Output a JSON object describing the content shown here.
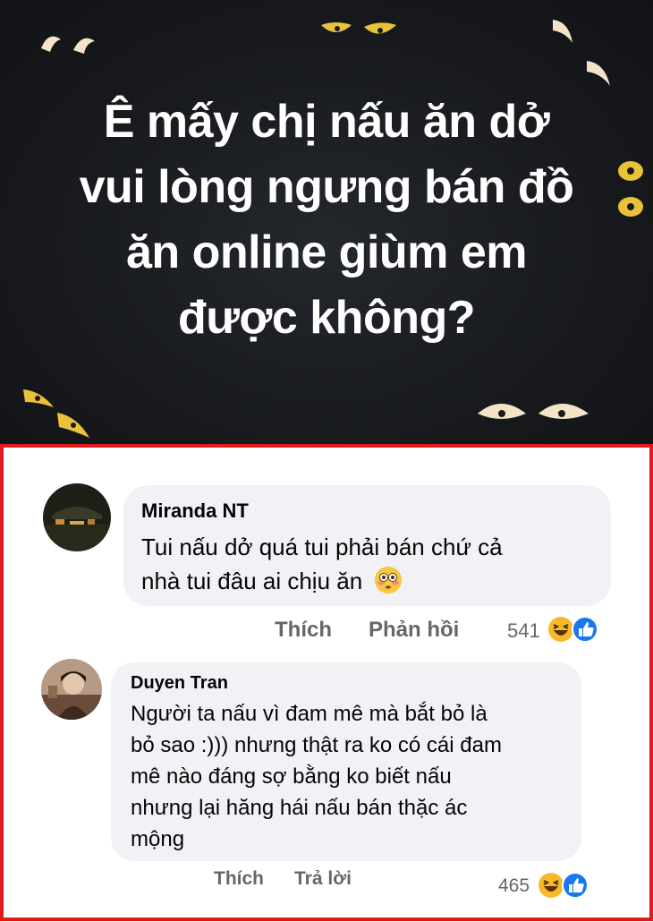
{
  "post": {
    "lines": [
      "Ê mấy chị nấu ăn dở",
      "vui lòng ngưng bán đồ",
      "ăn online giùm em",
      "được không?"
    ],
    "background_color": "#17191d",
    "text_color": "#ffffff"
  },
  "comments": [
    {
      "author": "Miranda NT",
      "text_lines": [
        "Tui nấu dở quá tui phải bán chứ cả",
        "nhà tui đâu ai chịu ăn"
      ],
      "emoji": "flushed-face",
      "like_label": "Thích",
      "reply_label": "Phản hồi",
      "reaction_count": "541",
      "reactions": [
        "haha",
        "like"
      ]
    },
    {
      "author": "Duyen Tran",
      "text_lines": [
        "Người ta nấu vì đam mê mà bắt bỏ là",
        "bỏ sao :))) nhưng thật ra ko có cái đam",
        "mê nào đáng sợ bằng ko biết nấu",
        "nhưng lại hăng hái nấu bán thặc ác",
        "mộng"
      ],
      "like_label": "Thích",
      "reply_label": "Trả lời",
      "reaction_count": "465",
      "reactions": [
        "haha",
        "like"
      ]
    }
  ],
  "colors": {
    "highlight_border": "#e01b1b",
    "bubble": "#f0f2f5",
    "secondary_text": "#65676b",
    "like_blue": "#1877f2",
    "haha_yellow": "#f7b928"
  }
}
